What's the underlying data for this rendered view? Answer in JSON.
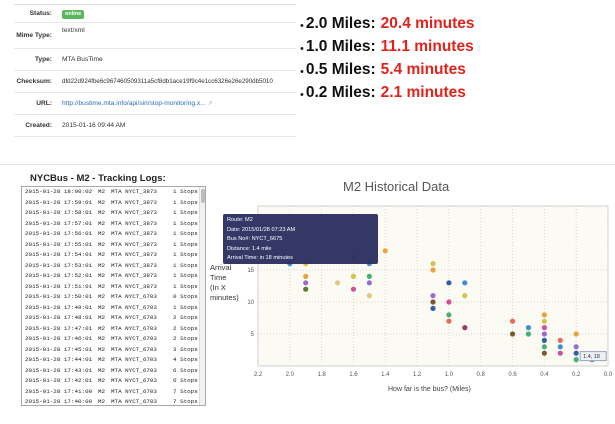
{
  "meta": {
    "rows": [
      {
        "key": "Status:",
        "value": "online",
        "badge": true
      },
      {
        "key": "Mime Type:",
        "value": "text/xml"
      },
      {
        "key": "Type:",
        "value": "MTA BusTime"
      },
      {
        "key": "Checksum:",
        "value": "dfd22d924fbe6c967460509311a5cf8db1ace19f9c4e1cc6326e26e290db5010"
      },
      {
        "key": "URL:",
        "value": "http://bustime.mta.info/api/siri/stop-monitoring.x...",
        "link": true
      },
      {
        "key": "Created:",
        "value": "2015-01-16 09:44 AM"
      }
    ]
  },
  "distances": [
    {
      "miles": "2.0 Miles:",
      "minutes": "20.4 minutes"
    },
    {
      "miles": "1.0 Miles:",
      "minutes": "11.1 minutes"
    },
    {
      "miles": "0.5 Miles:",
      "minutes": "5.4 minutes"
    },
    {
      "miles": "0.2 Miles:",
      "minutes": "2.1 minutes"
    }
  ],
  "logs": {
    "title": "NYCBus - M2 - Tracking Logs:",
    "rows": [
      [
        "2015-01-28 18:00:02",
        "M2",
        "MTA NYCT_3873",
        "1 Stops"
      ],
      [
        "2015-01-28 17:59:01",
        "M2",
        "MTA NYCT_3873",
        "1 Stops"
      ],
      [
        "2015-01-28 17:58:01",
        "M2",
        "MTA NYCT_3873",
        "1 Stops"
      ],
      [
        "2015-01-28 17:57:01",
        "M2",
        "MTA NYCT_3873",
        "1 Stops"
      ],
      [
        "2015-01-28 17:56:01",
        "M2",
        "MTA NYCT_3873",
        "1 Stops"
      ],
      [
        "2015-01-28 17:55:01",
        "M2",
        "MTA NYCT_3873",
        "1 Stops"
      ],
      [
        "2015-01-28 17:54:01",
        "M2",
        "MTA NYCT_3873",
        "1 Stops"
      ],
      [
        "2015-01-28 17:53:01",
        "M2",
        "MTA NYCT_3873",
        "1 Stops"
      ],
      [
        "2015-01-28 17:52:01",
        "M2",
        "MTA NYCT_3873",
        "1 Stops"
      ],
      [
        "2015-01-28 17:51:01",
        "M2",
        "MTA NYCT_3873",
        "1 Stops"
      ],
      [
        "2015-01-28 17:50:01",
        "M2",
        "MTA NYCT_6703",
        "0 Stops"
      ],
      [
        "2015-01-28 17:49:01",
        "M2",
        "MTA NYCT_6703",
        "1 Stops"
      ],
      [
        "2015-01-28 17:48:01",
        "M2",
        "MTA NYCT_6703",
        "2 Stops"
      ],
      [
        "2015-01-28 17:47:01",
        "M2",
        "MTA NYCT_6703",
        "2 Stops"
      ],
      [
        "2015-01-28 17:46:01",
        "M2",
        "MTA NYCT_6703",
        "2 Stops"
      ],
      [
        "2015-01-28 17:45:01",
        "M2",
        "MTA NYCT_6703",
        "3 Stops"
      ],
      [
        "2015-01-28 17:44:01",
        "M2",
        "MTA NYCT_6703",
        "4 Stops"
      ],
      [
        "2015-01-28 17:43:01",
        "M2",
        "MTA NYCT_6703",
        "6 Stops"
      ],
      [
        "2015-01-28 17:42:01",
        "M2",
        "MTA NYCT_6703",
        "6 Stops"
      ],
      [
        "2015-01-28 17:41:00",
        "M2",
        "MTA NYCT_6703",
        "7 Stops"
      ],
      [
        "2015-01-28 17:40:00",
        "M2",
        "MTA NYCT_6703",
        "7 Stops"
      ]
    ]
  },
  "chart_data": {
    "type": "scatter",
    "title": "M2 Historical Data",
    "ylabel": [
      "Arrival",
      "Time",
      "(In X",
      "minutes)"
    ],
    "xlabel": "How far is the bus? (Miles)",
    "x_reversed": true,
    "xlim": [
      0.0,
      2.2
    ],
    "ylim": [
      0,
      25
    ],
    "x_ticks": [
      "2.2",
      "2.0",
      "1.8",
      "1.6",
      "1.4",
      "1.2",
      "1.0",
      "0.8",
      "0.6",
      "0.4",
      "0.2",
      "0.0"
    ],
    "y_ticks": [
      "5",
      "10",
      "15"
    ],
    "grid": true,
    "legend": "none",
    "tooltip": {
      "lines": [
        "Route: M2",
        "Date: 2015/01/28 07:23 AM",
        "Bus No#: NYCT_6675",
        "Distance: 1.4 mile",
        "Arrival Time: in 18 minutes"
      ]
    },
    "hover_label": "1.4, 18",
    "points": [
      {
        "x": 2.0,
        "y": 16,
        "c": "#3b8fd6"
      },
      {
        "x": 1.9,
        "y": 16,
        "c": "#d9c24a"
      },
      {
        "x": 1.9,
        "y": 13,
        "c": "#9a6bd1"
      },
      {
        "x": 1.9,
        "y": 12,
        "c": "#5f7a2b"
      },
      {
        "x": 1.9,
        "y": 14,
        "c": "#e8a33c"
      },
      {
        "x": 1.7,
        "y": 13,
        "c": "#e2c87a"
      },
      {
        "x": 1.6,
        "y": 14,
        "c": "#d9c24a"
      },
      {
        "x": 1.6,
        "y": 12,
        "c": "#cf4f9e"
      },
      {
        "x": 1.6,
        "y": 17,
        "c": "#e86a5a"
      },
      {
        "x": 1.5,
        "y": 16,
        "c": "#3b8fd6"
      },
      {
        "x": 1.5,
        "y": 13,
        "c": "#9a6bd1"
      },
      {
        "x": 1.5,
        "y": 11,
        "c": "#e2c87a"
      },
      {
        "x": 1.5,
        "y": 14,
        "c": "#45b07a"
      },
      {
        "x": 1.4,
        "y": 18,
        "c": "#f0a23c"
      },
      {
        "x": 1.1,
        "y": 16,
        "c": "#d9c24a"
      },
      {
        "x": 1.1,
        "y": 15,
        "c": "#e8a33c"
      },
      {
        "x": 1.1,
        "y": 10,
        "c": "#7a5a2b"
      },
      {
        "x": 1.1,
        "y": 9,
        "c": "#2f5fa5"
      },
      {
        "x": 1.1,
        "y": 11,
        "c": "#9a6bd1"
      },
      {
        "x": 1.0,
        "y": 10,
        "c": "#cf4f9e"
      },
      {
        "x": 1.0,
        "y": 8,
        "c": "#45b07a"
      },
      {
        "x": 1.0,
        "y": 7,
        "c": "#e86a5a"
      },
      {
        "x": 1.0,
        "y": 13,
        "c": "#2f5fa5"
      },
      {
        "x": 0.9,
        "y": 11,
        "c": "#d9c24a"
      },
      {
        "x": 0.9,
        "y": 13,
        "c": "#3b8fd6"
      },
      {
        "x": 0.9,
        "y": 6,
        "c": "#9a3b6b"
      },
      {
        "x": 0.6,
        "y": 7,
        "c": "#e86a5a"
      },
      {
        "x": 0.6,
        "y": 5,
        "c": "#7a5a2b"
      },
      {
        "x": 0.5,
        "y": 6,
        "c": "#3b8fd6"
      },
      {
        "x": 0.5,
        "y": 5,
        "c": "#45b07a"
      },
      {
        "x": 0.4,
        "y": 8,
        "c": "#e8a33c"
      },
      {
        "x": 0.4,
        "y": 7,
        "c": "#d9c24a"
      },
      {
        "x": 0.4,
        "y": 6,
        "c": "#cf4f9e"
      },
      {
        "x": 0.4,
        "y": 5,
        "c": "#9a6bd1"
      },
      {
        "x": 0.4,
        "y": 4,
        "c": "#2f5fa5"
      },
      {
        "x": 0.4,
        "y": 3,
        "c": "#45b07a"
      },
      {
        "x": 0.4,
        "y": 2,
        "c": "#7a5a2b"
      },
      {
        "x": 0.3,
        "y": 4,
        "c": "#e86a5a"
      },
      {
        "x": 0.3,
        "y": 3,
        "c": "#3b8fd6"
      },
      {
        "x": 0.3,
        "y": 2,
        "c": "#cf4f9e"
      },
      {
        "x": 0.2,
        "y": 5,
        "c": "#e8a33c"
      },
      {
        "x": 0.2,
        "y": 3,
        "c": "#9a6bd1"
      },
      {
        "x": 0.2,
        "y": 2,
        "c": "#2f5fa5"
      },
      {
        "x": 0.2,
        "y": 1,
        "c": "#45b07a"
      },
      {
        "x": 0.1,
        "y": 1,
        "c": "#3b8fd6"
      }
    ]
  }
}
